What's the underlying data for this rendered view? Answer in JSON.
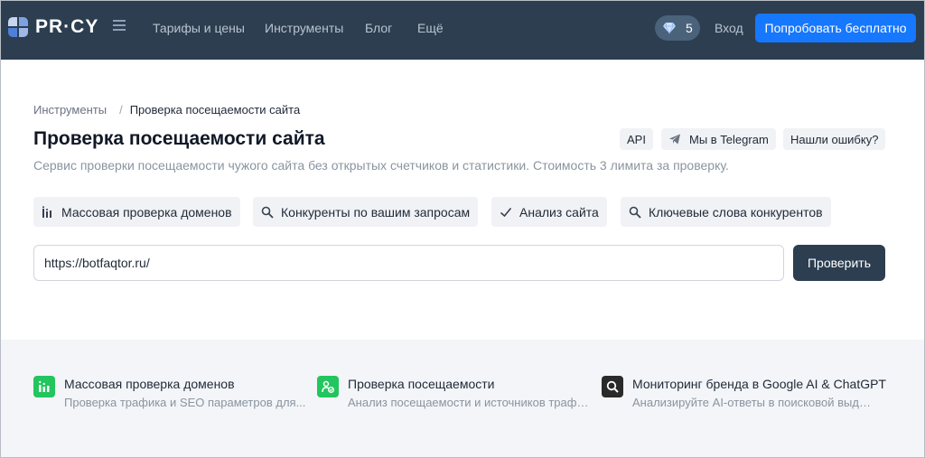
{
  "header": {
    "logo_text": "PR·CY",
    "nav": [
      "Тарифы и цены",
      "Инструменты",
      "Блог",
      "Ещё"
    ],
    "gems_count": "5",
    "login": "Вход",
    "cta": "Попробовать бесплатно",
    "colors": {
      "bar": "#2c3e50",
      "cta": "#1677ff"
    }
  },
  "breadcrumb": {
    "parent": "Инструменты",
    "separator": "/",
    "current": "Проверка посещаемости сайта"
  },
  "page": {
    "title": "Проверка посещаемости сайта",
    "subtitle": "Сервис проверки посещаемости чужого сайта без открытых счетчиков и статистики. Стоимость 3 лимита за проверку."
  },
  "chips": {
    "api": "API",
    "telegram": "Мы в Telegram",
    "report": "Нашли ошибку?"
  },
  "tools": [
    {
      "label": "Массовая проверка доменов",
      "icon": "bars-icon"
    },
    {
      "label": "Конкуренты по вашим запросам",
      "icon": "search-icon"
    },
    {
      "label": "Анализ сайта",
      "icon": "check-icon"
    },
    {
      "label": "Ключевые слова конкурентов",
      "icon": "search-icon"
    }
  ],
  "form": {
    "url_value": "https://botfaqtor.ru/",
    "submit": "Проверить"
  },
  "cards": [
    {
      "title": "Массовая проверка доменов",
      "desc": "Проверка трафика и SEO параметров для...",
      "icon": "bars-icon",
      "color": "#22c55e"
    },
    {
      "title": "Проверка посещаемости",
      "desc": "Анализ посещаемости и источников трафика.",
      "icon": "traffic-icon",
      "color": "#22c55e"
    },
    {
      "title": "Мониторинг бренда в Google AI & ChatGPT",
      "desc": "Анализируйте AI-ответы в поисковой выдач...",
      "icon": "search-icon",
      "color": "#2a2a2a"
    }
  ]
}
